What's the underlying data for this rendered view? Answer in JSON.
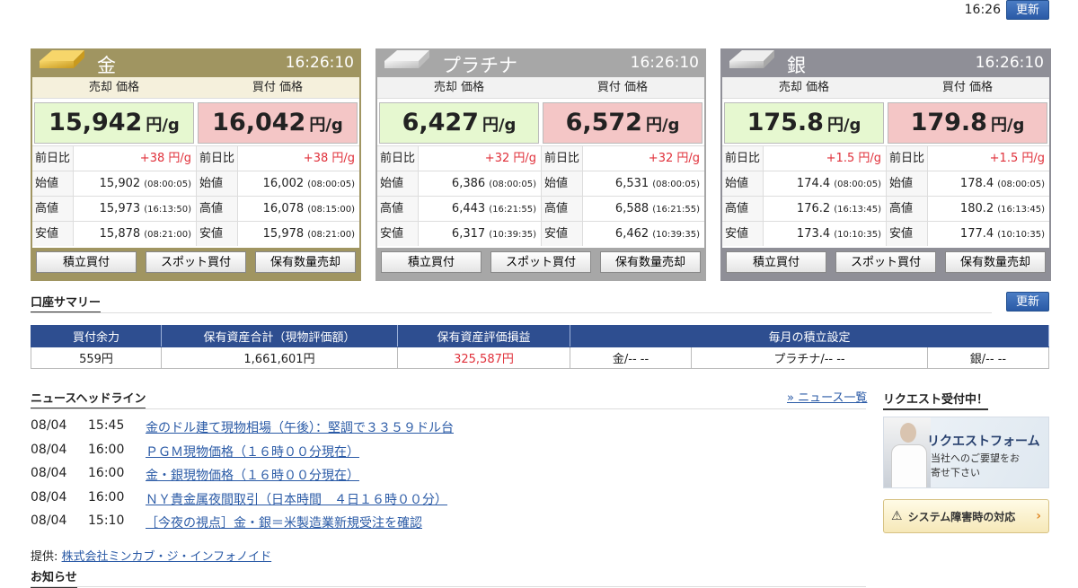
{
  "header": {
    "time": "16:26",
    "update_label": "更新"
  },
  "metals": [
    {
      "name": "金",
      "time": "16:26:10",
      "sell_label": "売却 価格",
      "buy_label": "買付 価格",
      "sell_price": "15,942",
      "buy_price": "16,042",
      "unit": "円/g",
      "stats": [
        {
          "key": "前日比",
          "sell": "+38 円/g",
          "sell_time": "",
          "buy": "+38 円/g",
          "buy_time": ""
        },
        {
          "key": "始値",
          "sell": "15,902",
          "sell_time": "(08:00:05)",
          "buy": "16,002",
          "buy_time": "(08:00:05)"
        },
        {
          "key": "高値",
          "sell": "15,973",
          "sell_time": "(16:13:50)",
          "buy": "16,078",
          "buy_time": "(08:15:00)"
        },
        {
          "key": "安値",
          "sell": "15,878",
          "sell_time": "(08:21:00)",
          "buy": "15,978",
          "buy_time": "(08:21:00)"
        }
      ],
      "actions": [
        "積立買付",
        "スポット買付",
        "保有数量売却"
      ]
    },
    {
      "name": "プラチナ",
      "time": "16:26:10",
      "sell_label": "売却 価格",
      "buy_label": "買付 価格",
      "sell_price": "6,427",
      "buy_price": "6,572",
      "unit": "円/g",
      "stats": [
        {
          "key": "前日比",
          "sell": "+32 円/g",
          "sell_time": "",
          "buy": "+32 円/g",
          "buy_time": ""
        },
        {
          "key": "始値",
          "sell": "6,386",
          "sell_time": "(08:00:05)",
          "buy": "6,531",
          "buy_time": "(08:00:05)"
        },
        {
          "key": "高値",
          "sell": "6,443",
          "sell_time": "(16:21:55)",
          "buy": "6,588",
          "buy_time": "(16:21:55)"
        },
        {
          "key": "安値",
          "sell": "6,317",
          "sell_time": "(10:39:35)",
          "buy": "6,462",
          "buy_time": "(10:39:35)"
        }
      ],
      "actions": [
        "積立買付",
        "スポット買付",
        "保有数量売却"
      ]
    },
    {
      "name": "銀",
      "time": "16:26:10",
      "sell_label": "売却 価格",
      "buy_label": "買付 価格",
      "sell_price": "175.8",
      "buy_price": "179.8",
      "unit": "円/g",
      "stats": [
        {
          "key": "前日比",
          "sell": "+1.5 円/g",
          "sell_time": "",
          "buy": "+1.5 円/g",
          "buy_time": ""
        },
        {
          "key": "始値",
          "sell": "174.4",
          "sell_time": "(08:00:05)",
          "buy": "178.4",
          "buy_time": "(08:00:05)"
        },
        {
          "key": "高値",
          "sell": "176.2",
          "sell_time": "(16:13:45)",
          "buy": "180.2",
          "buy_time": "(16:13:45)"
        },
        {
          "key": "安値",
          "sell": "173.4",
          "sell_time": "(10:10:35)",
          "buy": "177.4",
          "buy_time": "(10:10:35)"
        }
      ],
      "actions": [
        "積立買付",
        "スポット買付",
        "保有数量売却"
      ]
    }
  ],
  "summary": {
    "title": "口座サマリー",
    "update_label": "更新",
    "headers": [
      "買付余力",
      "保有資産合計（現物評価額）",
      "保有資産評価損益",
      "毎月の積立設定"
    ],
    "buying_power": "559円",
    "total_assets": "1,661,601円",
    "pnl": "325,587円",
    "plan_gold": "金/-- --",
    "plan_plat": "プラチナ/-- --",
    "plan_silver": "銀/-- --"
  },
  "news": {
    "title": "ニュースヘッドライン",
    "more_label": "» ニュース一覧",
    "items": [
      {
        "date": "08/04",
        "time": "15:45",
        "headline": "金のドル建て現物相場（午後）：堅調で３３５９ドル台"
      },
      {
        "date": "08/04",
        "time": "16:00",
        "headline": "ＰＧＭ現物価格（１６時００分現在）"
      },
      {
        "date": "08/04",
        "time": "16:00",
        "headline": "金・銀現物価格（１６時００分現在）"
      },
      {
        "date": "08/04",
        "time": "16:00",
        "headline": "ＮＹ貴金属夜間取引（日本時間　４日１６時００分）"
      },
      {
        "date": "08/04",
        "time": "15:10",
        "headline": "［今夜の視点］金・銀＝米製造業新規受注を確認"
      }
    ],
    "provider_label": "提供:",
    "provider_name": "株式会社ミンカブ・ジ・インフォノイド"
  },
  "notice": {
    "title": "お知らせ"
  },
  "request": {
    "title": "リクエスト受付中！",
    "banner_main": "リクエストフォーム",
    "banner_sub": "当社へのご要望をお寄せ下さい",
    "system_label": "システム障害時の対応"
  },
  "colors": {
    "gold": "#a09561",
    "platinum": "#a7a7a7",
    "silver": "#8f8f97",
    "accent_blue": "#2e4e90",
    "up_red": "#e0303a"
  }
}
